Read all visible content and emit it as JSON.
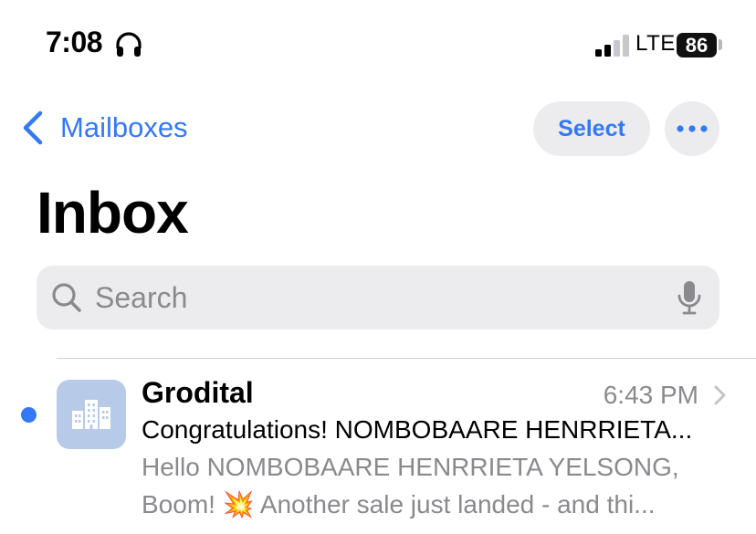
{
  "status_bar": {
    "time": "7:08",
    "network": "LTE",
    "battery": "86",
    "signal_bars_filled": 2,
    "signal_bars_total": 4
  },
  "nav": {
    "back_label": "Mailboxes",
    "select_label": "Select",
    "more_icon": "ellipsis-icon"
  },
  "title": "Inbox",
  "search": {
    "placeholder": "Search",
    "value": ""
  },
  "messages": [
    {
      "sender": "Grodital",
      "time": "6:43 PM",
      "subject": "Congratulations! NOMBOBAARE HENRRIETA...",
      "preview_line1": "Hello NOMBOBAARE HENRRIETA YELSONG,",
      "preview_line2": "Boom! 💥 Another sale just landed - and thi...",
      "unread": true,
      "avatar_icon": "building-icon"
    }
  ],
  "colors": {
    "accent": "#3478f6",
    "secondary_text": "#8a8a8e",
    "pill_bg": "#ececee",
    "avatar_bg": "#b7cbe9"
  }
}
